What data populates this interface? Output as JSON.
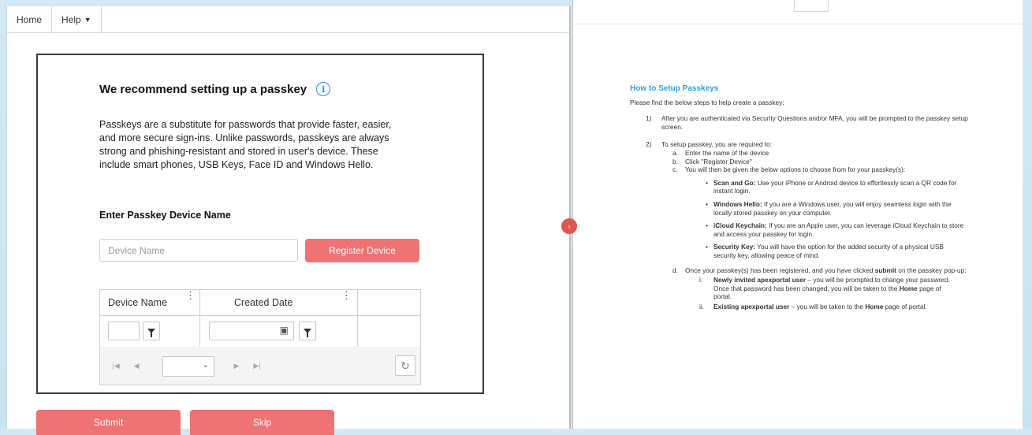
{
  "nav": {
    "home": "Home",
    "help": "Help"
  },
  "card": {
    "title": "We recommend setting up a passkey",
    "info_icon": "i",
    "description": "Passkeys are a substitute for passwords that provide faster, easier, and more secure sign-ins. Unlike passwords, passkeys are always strong and phishing-resistant and stored in user's device. These include smart phones, USB Keys, Face ID and Windows Hello.",
    "device_label": "Enter Passkey Device Name",
    "device_placeholder": "Device Name",
    "register_label": "Register Device",
    "grid": {
      "col1": "Device Name",
      "col2": "Created Date"
    }
  },
  "actions": {
    "submit": "Submit",
    "skip": "Skip"
  },
  "colors": {
    "accent_red": "#ef7274",
    "link_blue": "#2ea0df"
  },
  "icons": [
    "info-icon",
    "filter-icon",
    "calendar-icon",
    "first-page-icon",
    "prev-page-icon",
    "next-page-icon",
    "last-page-icon",
    "refresh-icon",
    "chevron-down-icon",
    "kebab-icon"
  ],
  "doc": {
    "title": "How to Setup Passkeys",
    "intro": "Please find the below steps to help create a passkey:",
    "step1_num": "1)",
    "step1": "After you are authenticated via Security Questions and/or MFA, you will be prompted to the passkey setup screen.",
    "step2_num": "2)",
    "step2": "To setup passkey, you are required to:",
    "a_num": "a.",
    "a": "Enter the name of the device",
    "b_num": "b.",
    "b": "Click \"Register Device\"",
    "c_num": "c.",
    "c": "You will then be given the below options to choose from for your passkey(s):",
    "bullets": [
      {
        "bold": "Scan and Go:",
        "text": " Use your iPhone or Android device to effortlessly scan a QR code for instant login."
      },
      {
        "bold": "Windows Hello:",
        "text": " If you are a Windows user, you will enjoy seamless login with the locally stored passkey on your computer."
      },
      {
        "bold": "iCloud Keychain:",
        "text": " If you are an Apple user, you can leverage iCloud Keychain to store and access your passkey for login."
      },
      {
        "bold": "Security Key:",
        "text": " You will have the option for the added security of a physical USB security key, allowing peace of mind."
      }
    ],
    "d_num": "d.",
    "d_pre": "Once your passkey(s) has been registered, and you have clicked ",
    "d_bold": "submit",
    "d_post": " on the passkey pop-up:",
    "i_num": "i.",
    "i_bold": "Newly invited apexportal user",
    "i_text_pre": " – you will be prompted to change your password. Once that password has been changed, you will be taken to the ",
    "i_home": "Home",
    "i_text_post": " page of portal.",
    "ii_num": "ii.",
    "ii_bold": "Existing apexportal user",
    "ii_text_pre": " – you will be taken to the ",
    "ii_home": "Home",
    "ii_text_post": " page of portal."
  }
}
